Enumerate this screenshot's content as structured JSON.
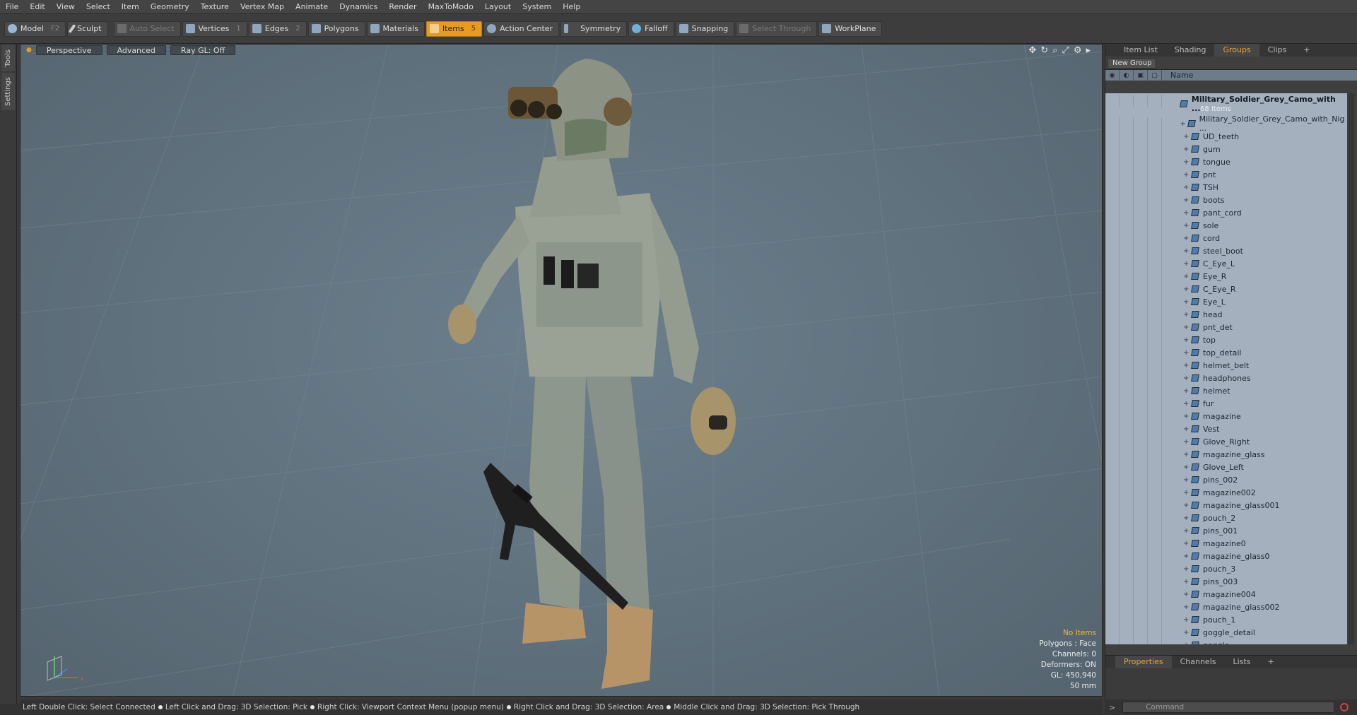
{
  "menu": [
    "File",
    "Edit",
    "View",
    "Select",
    "Item",
    "Geometry",
    "Texture",
    "Vertex Map",
    "Animate",
    "Dynamics",
    "Render",
    "MaxToModo",
    "Layout",
    "System",
    "Help"
  ],
  "toolbar": {
    "model": "Model",
    "model_key": "F2",
    "sculpt": "Sculpt",
    "auto_select": "Auto Select",
    "vertices": "Vertices",
    "vertices_num": "1",
    "edges": "Edges",
    "edges_num": "2",
    "polygons": "Polygons",
    "materials": "Materials",
    "items": "Items",
    "items_num": "5",
    "action_center": "Action Center",
    "symmetry": "Symmetry",
    "falloff": "Falloff",
    "snapping": "Snapping",
    "select_through": "Select Through",
    "workplane": "WorkPlane"
  },
  "left_tabs": [
    "Tools",
    "Settings"
  ],
  "viewport": {
    "perspective": "Perspective",
    "advanced": "Advanced",
    "raygl": "Ray GL: Off",
    "info": {
      "no_items": "No Items",
      "polygons": "Polygons : Face",
      "channels": "Channels: 0",
      "deformers": "Deformers: ON",
      "gl": "GL: 450,940",
      "focal": "50 mm"
    }
  },
  "right_panel": {
    "tabs": [
      "Item List",
      "Shading",
      "Groups",
      "Clips"
    ],
    "active_tab": "Groups",
    "new_group": "New Group",
    "header_name": "Name",
    "group_name": "Military_Soldier_Grey_Camo_with ...",
    "group_count": "68 Items",
    "items": [
      "Military_Soldier_Grey_Camo_with_Nig ...",
      "UD_teeth",
      "gum",
      "tongue",
      "pnt",
      "TSH",
      "boots",
      "pant_cord",
      "sole",
      "cord",
      "steel_boot",
      "C_Eye_L",
      "Eye_R",
      "C_Eye_R",
      "Eye_L",
      "head",
      "pnt_det",
      "top",
      "top_detail",
      "helmet_belt",
      "headphones",
      "helmet",
      "fur",
      "magazine",
      "Vest",
      "Glove_Right",
      "magazine_glass",
      "Glove_Left",
      "pins_002",
      "magazine002",
      "magazine_glass001",
      "pouch_2",
      "pins_001",
      "magazine0",
      "magazine_glass0",
      "pouch_3",
      "pins_003",
      "magazine004",
      "magazine_glass002",
      "pouch_1",
      "goggle_detail",
      "goggle"
    ]
  },
  "properties": {
    "tabs": [
      "Properties",
      "Channels",
      "Lists"
    ],
    "active_tab": "Properties"
  },
  "command_placeholder": "Command",
  "status": [
    "Left Double Click: Select Connected",
    "Left Click and Drag: 3D Selection: Pick",
    "Right Click: Viewport Context Menu (popup menu)",
    "Right Click and Drag: 3D Selection: Area",
    "Middle Click and Drag: 3D Selection: Pick Through"
  ],
  "colors": {
    "accent": "#e79b1f",
    "viewport_bg": "#5f717d",
    "tree_bg": "#a4b0bd"
  }
}
